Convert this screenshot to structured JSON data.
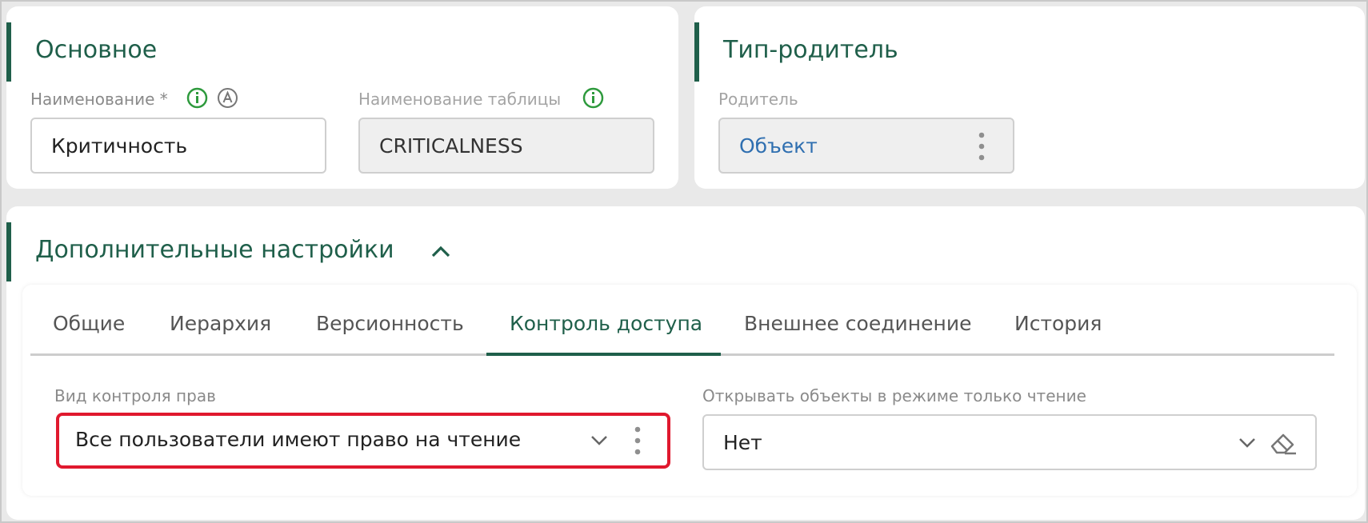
{
  "main": {
    "title": "Основное",
    "name_label": "Наименование *",
    "name_value": "Критичность",
    "table_label": "Наименование таблицы",
    "table_value": "CRITICALNESS"
  },
  "parent": {
    "title": "Тип-родитель",
    "label": "Родитель",
    "value": "Объект"
  },
  "additional": {
    "title": "Дополнительные настройки",
    "tabs": [
      {
        "label": "Общие"
      },
      {
        "label": "Иерархия"
      },
      {
        "label": "Версионность"
      },
      {
        "label": "Контроль доступа"
      },
      {
        "label": "Внешнее соединение"
      },
      {
        "label": "История"
      }
    ],
    "active_tab": "Контроль доступа",
    "access_label": "Вид контроля прав",
    "access_value": "Все пользователи имеют право на чтение",
    "readonly_label": "Открывать объекты в режиме только чтение",
    "readonly_value": "Нет"
  },
  "colors": {
    "accent": "#1f5f4a",
    "link": "#2f6fb0",
    "info_green": "#2e9a3d",
    "highlight_red": "#e0192e"
  }
}
